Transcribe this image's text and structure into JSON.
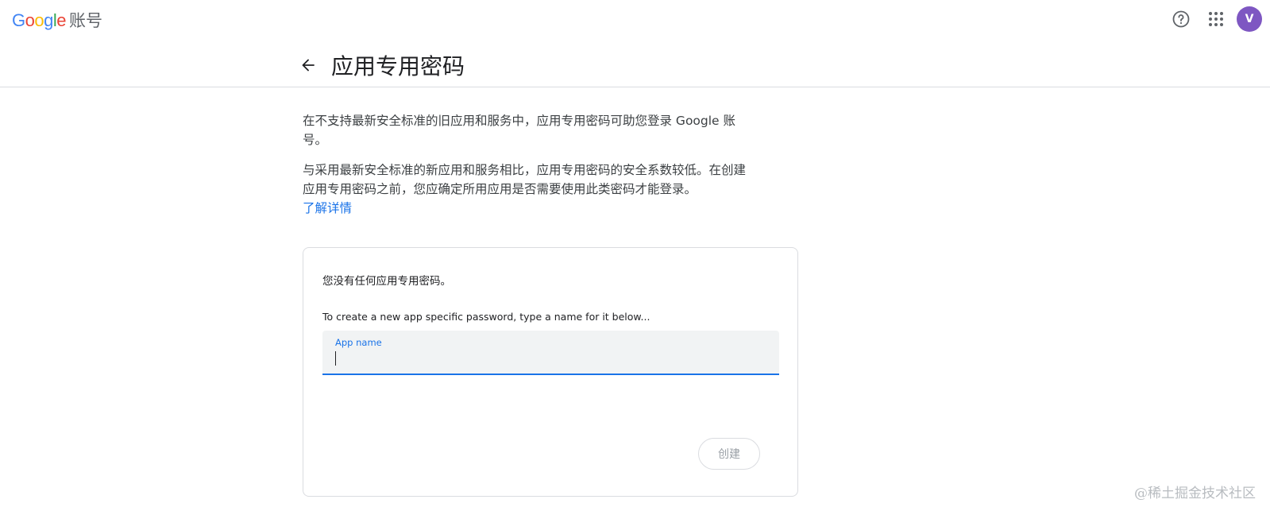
{
  "header": {
    "logo_letters": [
      "G",
      "o",
      "o",
      "g",
      "l",
      "e"
    ],
    "product": "账号",
    "help_icon": "help-circle-icon",
    "apps_icon": "apps-grid-icon",
    "avatar_initial": "V",
    "avatar_color": "#7e57c2"
  },
  "page": {
    "back_icon": "arrow-back-icon",
    "title": "应用专用密码"
  },
  "intro": {
    "para1": "在不支持最新安全标准的旧应用和服务中，应用专用密码可助您登录 Google 账号。",
    "para2": "与采用最新安全标准的新应用和服务相比，应用专用密码的安全系数较低。在创建应用专用密码之前，您应确定所用应用是否需要使用此类密码才能登录。",
    "learn_more": "了解详情"
  },
  "card": {
    "empty_message": "您没有任何应用专用密码。",
    "hint": "To create a new app specific password, type a name for it below...",
    "field_label": "App name",
    "field_value": "",
    "create_button": "创建"
  },
  "watermark": "@稀土掘金技术社区",
  "colors": {
    "accent": "#1a73e8",
    "google_blue": "#4285f4",
    "google_red": "#ea4335",
    "google_yellow": "#fbbc05",
    "google_green": "#34a853"
  }
}
